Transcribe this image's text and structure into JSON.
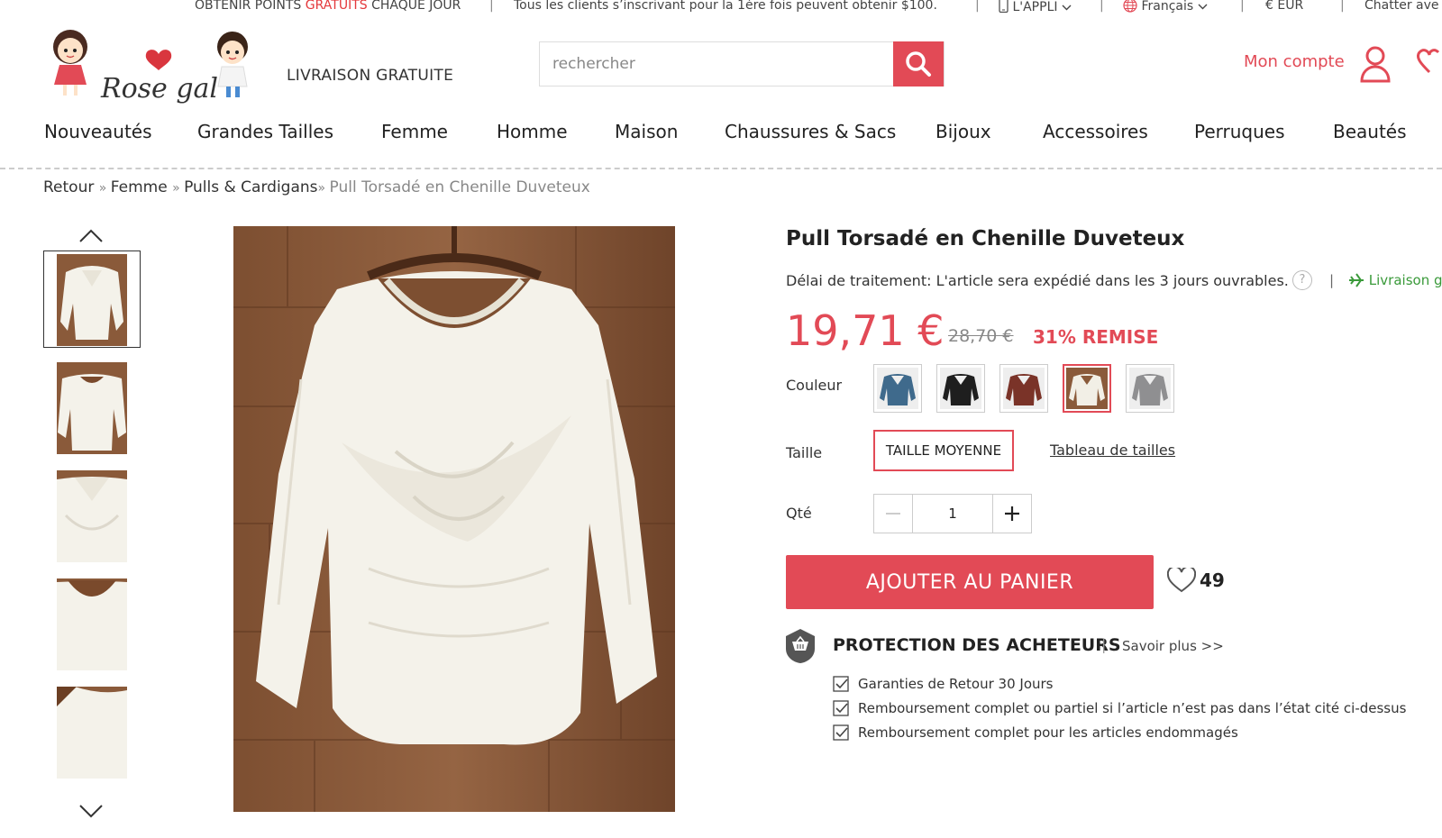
{
  "topbar": {
    "points_pre": "OBTENIR POINTS ",
    "points_red": "GRATUITS",
    "points_post": " CHAQUE JOUR",
    "promo": "Tous les clients s’inscrivant pour la 1ère fois peuvent obtenir $100.",
    "app": "L'APPLI",
    "language": "Français",
    "currency": "€ EUR",
    "chat": "Chatter ave"
  },
  "header": {
    "logo_text": "Rose gal",
    "free_shipping": "LIVRAISON GRATUITE",
    "search_placeholder": "rechercher",
    "account": "Mon compte"
  },
  "nav": {
    "items": [
      "Nouveautés",
      "Grandes Tailles",
      "Femme",
      "Homme",
      "Maison",
      "Chaussures & Sacs",
      "Bijoux",
      "Accessoires",
      "Perruques",
      "Beautés"
    ]
  },
  "breadcrumb": {
    "items": [
      "Retour",
      "Femme",
      "Pulls & Cardigans"
    ],
    "current": "Pull Torsadé en Chenille Duveteux"
  },
  "product": {
    "title": "Pull Torsadé en Chenille Duveteux",
    "delay": "Délai de traitement: L'article sera expédié dans les 3 jours ouvrables.",
    "help": "?",
    "shipping_link": "Livraison g",
    "price": "19,71 €",
    "old_price": "28,70 €",
    "discount": "31% REMISE",
    "color_label": "Couleur",
    "colors": [
      "#3f6a8c",
      "#1e1e1e",
      "#7a3328",
      "#f2efe6",
      "#8f8f91"
    ],
    "selected_color_index": 3,
    "size_label": "Taille",
    "size_value": "TAILLE MOYENNE",
    "size_chart": "Tableau de tailles",
    "qty_label": "Qté",
    "qty_value": "1",
    "add_to_cart": "AJOUTER AU PANIER",
    "wishlist_count": "49"
  },
  "protection": {
    "title": "PROTECTION DES ACHETEURS",
    "learn_more": "Savoir plus >>",
    "items": [
      "Garanties de Retour 30 Jours",
      "Remboursement complet ou partiel si l’article n’est pas dans l’état cité ci-dessus",
      "Remboursement complet pour les articles endommagés"
    ]
  },
  "colors": {
    "accent": "#e24a56",
    "green": "#3a9a3a",
    "wood": "#8a5a3a",
    "sweater": "#f4f2ea"
  }
}
